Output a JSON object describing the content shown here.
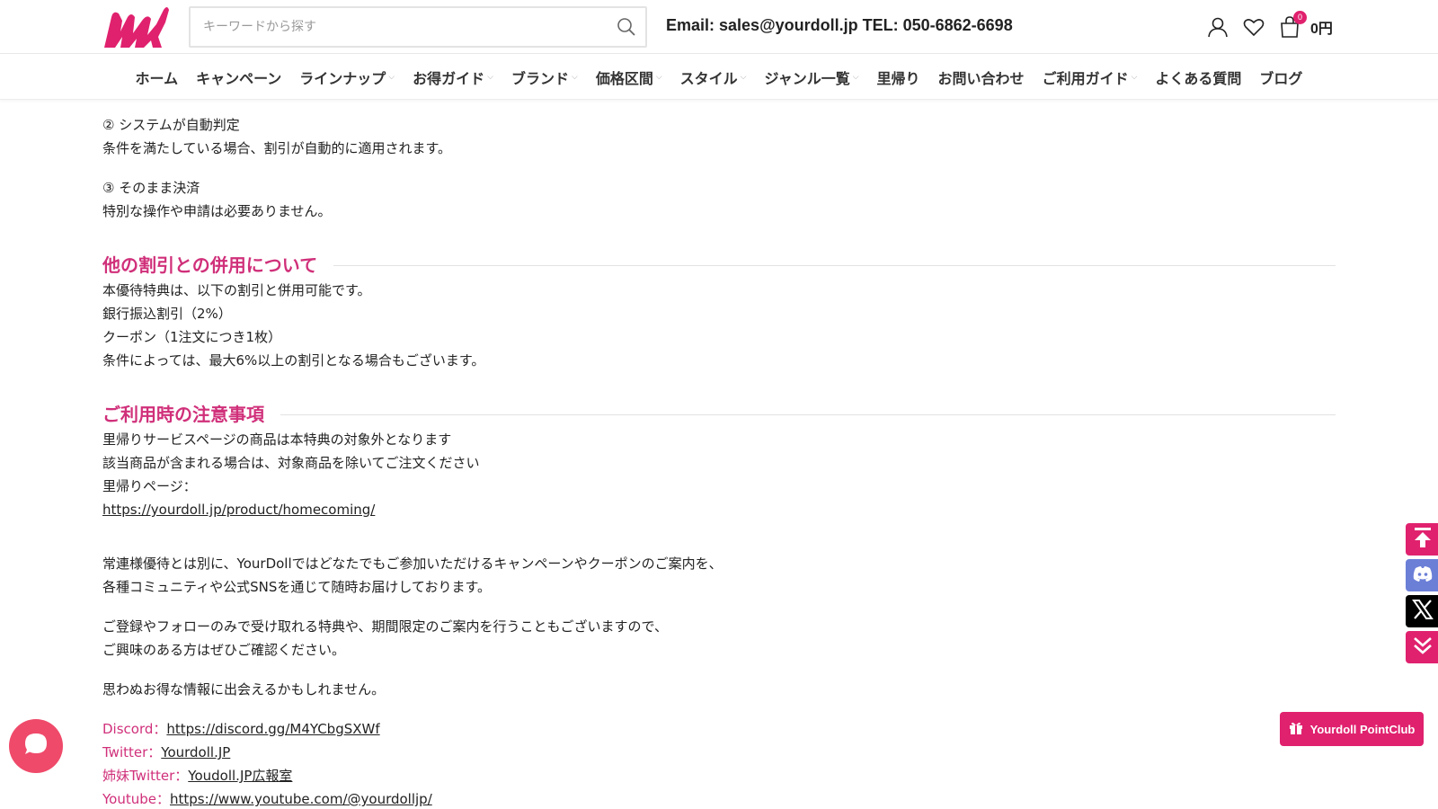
{
  "header": {
    "search_placeholder": "キーワードから探す",
    "contact_text": "Email: sales@yourdoll.jp TEL: 050-6862-6698",
    "cart_count": "0",
    "cart_total": "0円"
  },
  "nav": {
    "items": [
      {
        "label": "ホーム",
        "dropdown": false
      },
      {
        "label": "キャンペーン",
        "dropdown": false
      },
      {
        "label": "ラインナップ",
        "dropdown": true
      },
      {
        "label": "お得ガイド",
        "dropdown": true
      },
      {
        "label": "ブランド",
        "dropdown": true
      },
      {
        "label": "価格区間",
        "dropdown": true
      },
      {
        "label": "スタイル",
        "dropdown": true
      },
      {
        "label": "ジャンル一覧",
        "dropdown": true
      },
      {
        "label": "里帰り",
        "dropdown": false
      },
      {
        "label": "お問い合わせ",
        "dropdown": false
      },
      {
        "label": "ご利用ガイド",
        "dropdown": true
      },
      {
        "label": "よくある質問",
        "dropdown": false
      },
      {
        "label": "ブログ",
        "dropdown": false
      }
    ]
  },
  "content": {
    "step2_title": "② システムが自動判定",
    "step2_text": "条件を満たしている場合、割引が自動的に適用されます。",
    "step3_title": "③ そのまま決済",
    "step3_text": "特別な操作や申請は必要ありません。",
    "section1": {
      "heading": "他の割引との併用について",
      "lines": [
        "本優待特典は、以下の割引と併用可能です。",
        "銀行振込割引（2%）",
        "クーポン（1注文につき1枚）",
        "条件によっては、最大6%以上の割引となる場合もございます。"
      ]
    },
    "section2": {
      "heading": "ご利用時の注意事項",
      "lines": [
        "里帰りサービスページの商品は本特典の対象外となります",
        "該当商品が含まれる場合は、対象商品を除いてご注文ください",
        "里帰りページ："
      ],
      "link": "https://yourdoll.jp/product/homecoming/"
    },
    "para1": [
      "常連様優待とは別に、YourDollではどなたでもご参加いただけるキャンペーンやクーポンのご案内を、",
      "各種コミュニティや公式SNSを通じて随時お届けしております。"
    ],
    "para2": [
      "ご登録やフォローのみで受け取れる特典や、期間限定のご案内を行うこともございますので、",
      "ご興味のある方はぜひご確認ください。"
    ],
    "para3": "思わぬお得な情報に出会えるかもしれません。",
    "social": [
      {
        "label": "Discord：",
        "link": "https://discord.gg/M4YCbgSXWf"
      },
      {
        "label": "Twitter：",
        "link": "Yourdoll.JP"
      },
      {
        "label": "姉妹Twitter：",
        "link": "Youdoll.JP広報室"
      },
      {
        "label": "Youtube：",
        "link": "https://www.youtube.com/@yourdolljp/"
      }
    ]
  },
  "floating": {
    "pointclub_label": "Yourdoll PointClub"
  },
  "colors": {
    "brand_pink": "#e0216e",
    "heading_pink": "#d0307a",
    "discord_blue": "#6b7fd7",
    "x_black": "#000000"
  }
}
